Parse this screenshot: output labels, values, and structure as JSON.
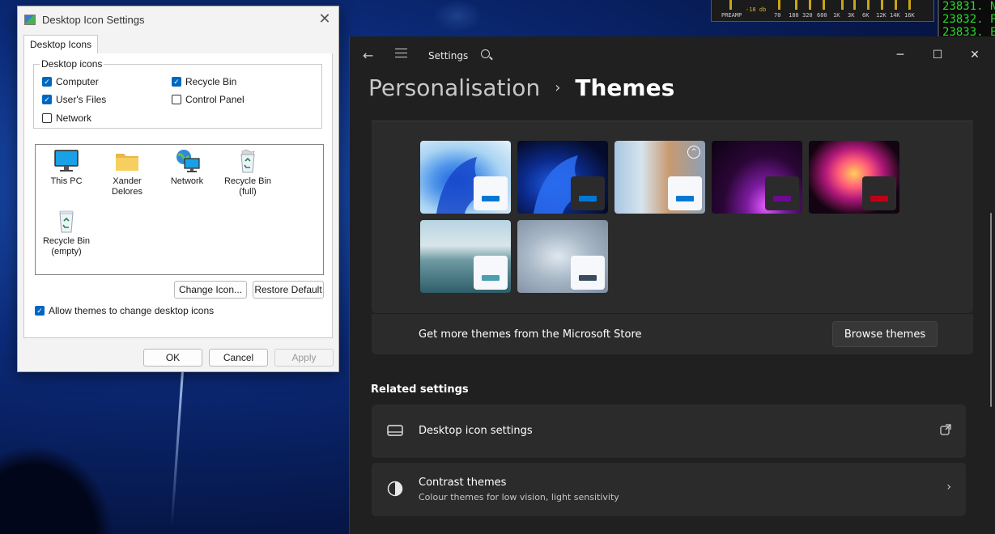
{
  "desktop": {
    "eq_preamp": "PREAMP",
    "eq_db": "-18 db",
    "eq_bands": [
      "70",
      "180",
      "320",
      "600",
      "1K",
      "3K",
      "6K",
      "12K",
      "14K",
      "16K"
    ],
    "console_lines": [
      "23831. N",
      "23832. P",
      "23833. E"
    ]
  },
  "dialog": {
    "title": "Desktop Icon Settings",
    "close_icon": "close-icon",
    "tab": "Desktop Icons",
    "group_label": "Desktop icons",
    "checkboxes": [
      {
        "label": "Computer",
        "checked": true
      },
      {
        "label": "Recycle Bin",
        "checked": true
      },
      {
        "label": "User's Files",
        "checked": true
      },
      {
        "label": "Control Panel",
        "checked": false
      },
      {
        "label": "Network",
        "checked": false
      }
    ],
    "icons": [
      {
        "label": "This PC",
        "icon": "monitor-icon"
      },
      {
        "label": "Xander Delores",
        "icon": "folder-icon"
      },
      {
        "label": "Network",
        "icon": "network-icon"
      },
      {
        "label": "Recycle Bin (full)",
        "icon": "recycle-bin-full-icon"
      },
      {
        "label": "Recycle Bin (empty)",
        "icon": "recycle-bin-empty-icon"
      }
    ],
    "change_icon_button": "Change Icon...",
    "restore_default_button": "Restore Default",
    "allow_themes": {
      "label": "Allow themes to change desktop icons",
      "checked": true
    },
    "ok_button": "OK",
    "cancel_button": "Cancel",
    "apply_button": "Apply"
  },
  "settings": {
    "app_title": "Settings",
    "breadcrumb": {
      "parent": "Personalisation",
      "separator": "›",
      "current": "Themes"
    },
    "themes": [
      {
        "accent": "#0078d4"
      },
      {
        "accent": "#0078d4"
      },
      {
        "accent": "#0078d4"
      },
      {
        "accent": "#6b0b8f"
      },
      {
        "accent": "#c00018"
      },
      {
        "accent": "#4a9fb0"
      },
      {
        "accent": "#3b4a5e"
      }
    ],
    "store_text": "Get more themes from the Microsoft Store",
    "browse_button": "Browse themes",
    "related_heading": "Related settings",
    "desktop_icon_settings": {
      "title": "Desktop icon settings",
      "icon": "monitor-icon",
      "trail_icon": "open-external-icon"
    },
    "contrast_themes": {
      "title": "Contrast themes",
      "subtitle": "Colour themes for low vision, light sensitivity",
      "icon": "contrast-icon",
      "trail_icon": "chevron-right-icon"
    }
  }
}
